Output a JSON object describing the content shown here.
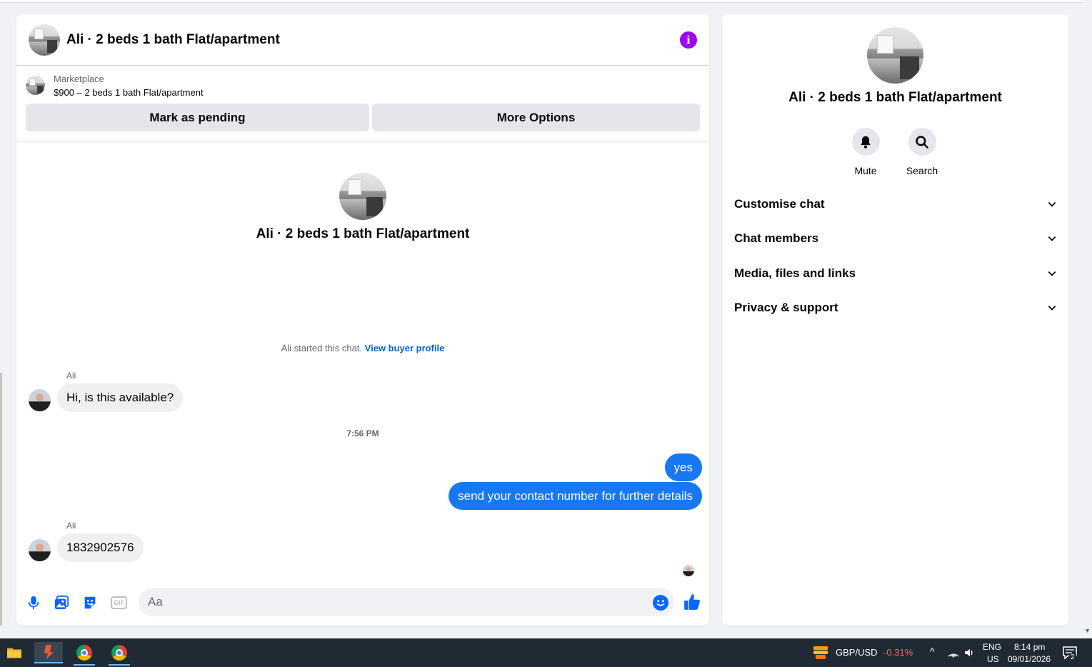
{
  "header": {
    "title": "Ali · 2 beds 1 bath Flat/apartment"
  },
  "marketplace": {
    "label": "Marketplace",
    "listing": "$900 – 2 beds 1 bath Flat/apartment",
    "mark_pending_label": "Mark as pending",
    "more_options_label": "More Options"
  },
  "intro": {
    "title": "Ali · 2 beds 1 bath Flat/apartment"
  },
  "chat": {
    "started_text": "Ali started this chat.",
    "view_profile_link": "View buyer profile",
    "messages": [
      {
        "sender": "Ali",
        "text": "Hi, is this available?",
        "direction": "in"
      },
      {
        "text": "yes",
        "direction": "out"
      },
      {
        "text": "send your contact number for further details",
        "direction": "out"
      },
      {
        "sender": "Ali",
        "text": "1832902576",
        "direction": "in"
      }
    ],
    "timestamp": "7:56 PM"
  },
  "composer": {
    "placeholder": "Aa",
    "gif_label": "GIF"
  },
  "info_panel": {
    "title": "Ali · 2 beds 1 bath Flat/apartment",
    "actions": [
      {
        "label": "Mute",
        "icon": "bell-icon"
      },
      {
        "label": "Search",
        "icon": "search-icon"
      }
    ],
    "sections": [
      {
        "label": "Customise chat"
      },
      {
        "label": "Chat members"
      },
      {
        "label": "Media, files and links"
      },
      {
        "label": "Privacy & support"
      }
    ]
  },
  "taskbar": {
    "ticker": "GBP/USD",
    "change": "-0.31%",
    "lang_top": "ENG",
    "lang_bottom": "US",
    "time": "8:14 pm",
    "date": "09/01/2026",
    "notifications": "2"
  },
  "colors": {
    "accent": "#1877f2",
    "info_icon": "#a000f0",
    "change_negative": "#ff6b6b"
  }
}
